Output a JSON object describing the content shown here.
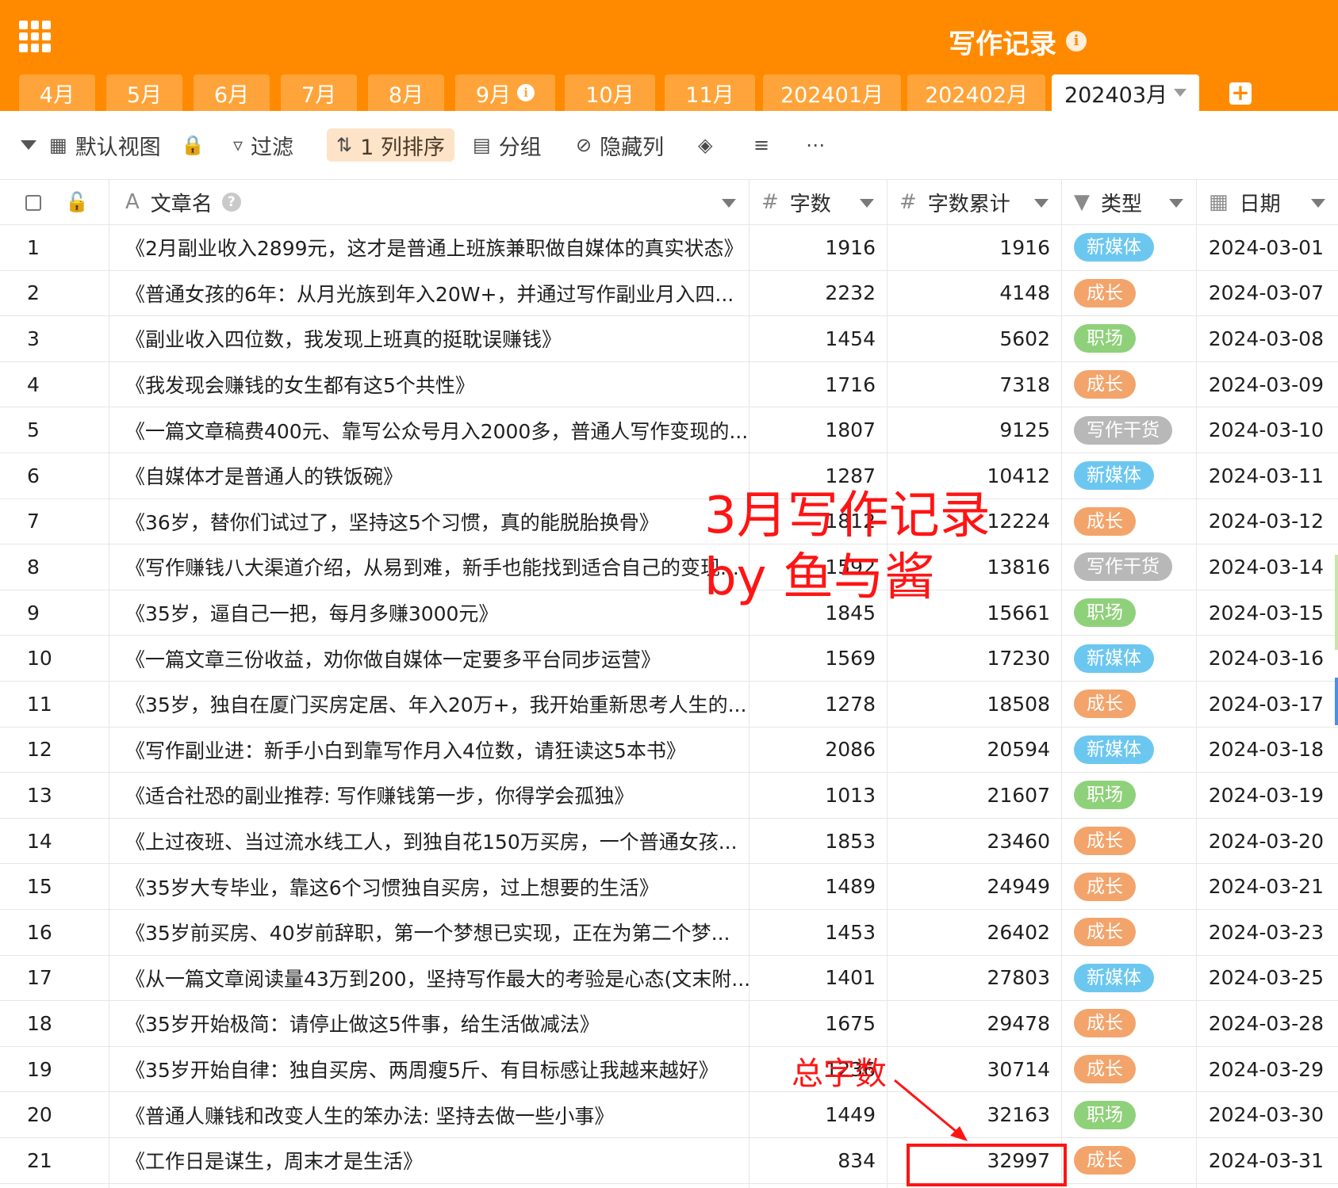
{
  "app": {
    "title": "写作记录"
  },
  "tabs": [
    {
      "label": "4月"
    },
    {
      "label": "5月"
    },
    {
      "label": "6月"
    },
    {
      "label": "7月"
    },
    {
      "label": "8月"
    },
    {
      "label": "9月",
      "info": true
    },
    {
      "label": "10月"
    },
    {
      "label": "11月"
    },
    {
      "label": "202401月"
    },
    {
      "label": "202402月"
    },
    {
      "label": "202403月",
      "active": true
    }
  ],
  "toolbar": {
    "view_label": "默认视图",
    "filter_label": "过滤",
    "sort_label": "1 列排序",
    "group_label": "分组",
    "hide_label": "隐藏列"
  },
  "columns": {
    "title": "文章名",
    "words": "字数",
    "cumulative": "字数累计",
    "type": "类型",
    "date": "日期"
  },
  "tag_colors": {
    "新媒体": "#6cc7f0",
    "成长": "#f3a46b",
    "职场": "#8fd17a",
    "写作干货": "#b8b8b8"
  },
  "rows": [
    {
      "idx": "1",
      "title": "《2月副业收入2899元，这才是普通上班族兼职做自媒体的真实状态》",
      "words": "1916",
      "cumulative": "1916",
      "type": "新媒体",
      "date": "2024-03-01"
    },
    {
      "idx": "2",
      "title": "《普通女孩的6年：从月光族到年入20W+，并通过写作副业月入四...",
      "words": "2232",
      "cumulative": "4148",
      "type": "成长",
      "date": "2024-03-07"
    },
    {
      "idx": "3",
      "title": "《副业收入四位数，我发现上班真的挺耽误赚钱》",
      "words": "1454",
      "cumulative": "5602",
      "type": "职场",
      "date": "2024-03-08"
    },
    {
      "idx": "4",
      "title": "《我发现会赚钱的女生都有这5个共性》",
      "words": "1716",
      "cumulative": "7318",
      "type": "成长",
      "date": "2024-03-09"
    },
    {
      "idx": "5",
      "title": "《一篇文章稿费400元、靠写公众号月入2000多，普通人写作变现的...",
      "words": "1807",
      "cumulative": "9125",
      "type": "写作干货",
      "date": "2024-03-10"
    },
    {
      "idx": "6",
      "title": "《自媒体才是普通人的铁饭碗》",
      "words": "1287",
      "cumulative": "10412",
      "type": "新媒体",
      "date": "2024-03-11"
    },
    {
      "idx": "7",
      "title": "《36岁，替你们试过了，坚持这5个习惯，真的能脱胎换骨》",
      "words": "1812",
      "cumulative": "12224",
      "type": "成长",
      "date": "2024-03-12"
    },
    {
      "idx": "8",
      "title": "《写作赚钱八大渠道介绍，从易到难，新手也能找到适合自己的变现...",
      "words": "1592",
      "cumulative": "13816",
      "type": "写作干货",
      "date": "2024-03-14"
    },
    {
      "idx": "9",
      "title": "《35岁，逼自己一把，每月多赚3000元》",
      "words": "1845",
      "cumulative": "15661",
      "type": "职场",
      "date": "2024-03-15"
    },
    {
      "idx": "10",
      "title": "《一篇文章三份收益，劝你做自媒体一定要多平台同步运营》",
      "words": "1569",
      "cumulative": "17230",
      "type": "新媒体",
      "date": "2024-03-16"
    },
    {
      "idx": "11",
      "title": "《35岁，独自在厦门买房定居、年入20万+，我开始重新思考人生的...",
      "words": "1278",
      "cumulative": "18508",
      "type": "成长",
      "date": "2024-03-17"
    },
    {
      "idx": "12",
      "title": "《写作副业进：新手小白到靠写作月入4位数，请狂读这5本书》",
      "words": "2086",
      "cumulative": "20594",
      "type": "新媒体",
      "date": "2024-03-18"
    },
    {
      "idx": "13",
      "title": "《适合社恐的副业推荐: 写作赚钱第一步，你得学会孤独》",
      "words": "1013",
      "cumulative": "21607",
      "type": "职场",
      "date": "2024-03-19"
    },
    {
      "idx": "14",
      "title": "《上过夜班、当过流水线工人，到独自花150万买房，一个普通女孩...",
      "words": "1853",
      "cumulative": "23460",
      "type": "成长",
      "date": "2024-03-20"
    },
    {
      "idx": "15",
      "title": "《35岁大专毕业，靠这6个习惯独自买房，过上想要的生活》",
      "words": "1489",
      "cumulative": "24949",
      "type": "成长",
      "date": "2024-03-21"
    },
    {
      "idx": "16",
      "title": "《35岁前买房、40岁前辞职，第一个梦想已实现，正在为第二个梦...",
      "words": "1453",
      "cumulative": "26402",
      "type": "成长",
      "date": "2024-03-23"
    },
    {
      "idx": "17",
      "title": "《从一篇文章阅读量43万到200，坚持写作最大的考验是心态(文末附...",
      "words": "1401",
      "cumulative": "27803",
      "type": "新媒体",
      "date": "2024-03-25"
    },
    {
      "idx": "18",
      "title": "《35岁开始极简：请停止做这5件事，给生活做减法》",
      "words": "1675",
      "cumulative": "29478",
      "type": "成长",
      "date": "2024-03-28"
    },
    {
      "idx": "19",
      "title": "《35岁开始自律：独自买房、两周瘦5斤、有目标感让我越来越好》",
      "words": "1236",
      "cumulative": "30714",
      "type": "成长",
      "date": "2024-03-29"
    },
    {
      "idx": "20",
      "title": "《普通人赚钱和改变人生的笨办法: 坚持去做一些小事》",
      "words": "1449",
      "cumulative": "32163",
      "type": "职场",
      "date": "2024-03-30"
    },
    {
      "idx": "21",
      "title": "《工作日是谋生，周末才是生活》",
      "words": "834",
      "cumulative": "32997",
      "type": "成长",
      "date": "2024-03-31"
    }
  ],
  "annotations": {
    "title_line1": "3月写作记录",
    "title_line2": "by 鱼与酱",
    "total_label": "总字数"
  }
}
